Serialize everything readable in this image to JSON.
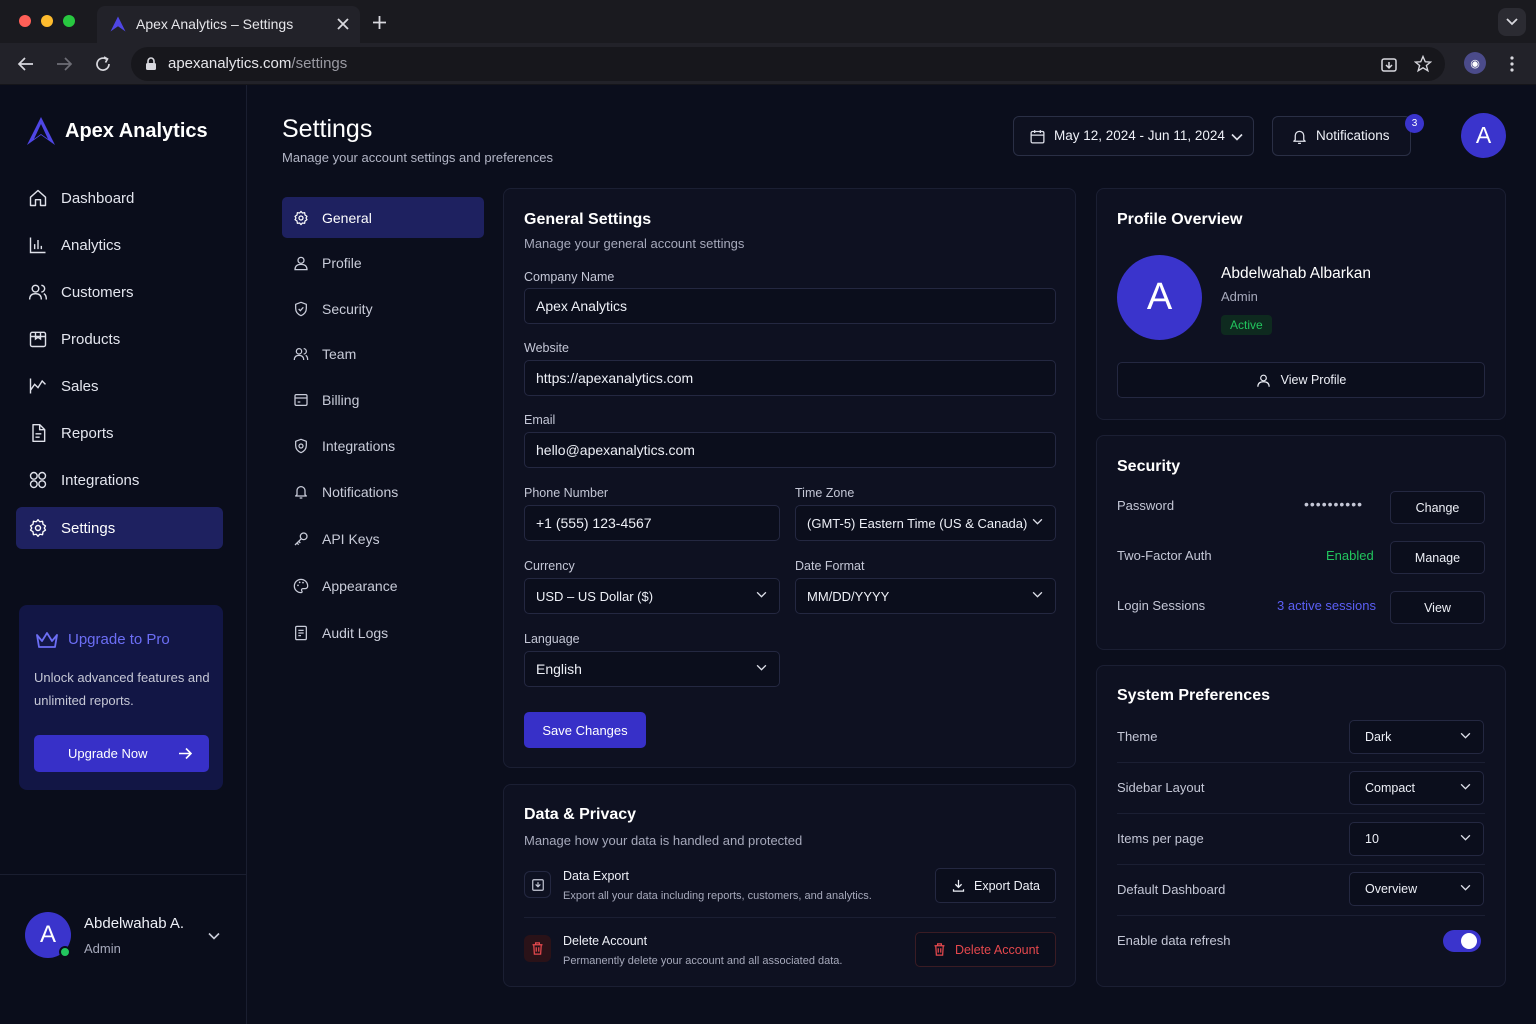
{
  "browser": {
    "tab_title": "Apex Analytics – Settings",
    "url_host": "apexanalytics.com",
    "url_path": "/settings"
  },
  "brand": {
    "name": "Apex Analytics",
    "accent": "#3a34cc"
  },
  "sidebar": {
    "items": [
      {
        "label": "Dashboard",
        "icon": "home-icon"
      },
      {
        "label": "Analytics",
        "icon": "bar-chart-icon"
      },
      {
        "label": "Customers",
        "icon": "users-icon"
      },
      {
        "label": "Products",
        "icon": "box-icon"
      },
      {
        "label": "Sales",
        "icon": "trend-icon"
      },
      {
        "label": "Reports",
        "icon": "file-icon"
      },
      {
        "label": "Integrations",
        "icon": "grid-icon"
      },
      {
        "label": "Settings",
        "icon": "gear-icon",
        "active": true
      }
    ],
    "upgrade": {
      "title": "Upgrade to Pro",
      "text": "Unlock advanced features and unlimited reports.",
      "button": "Upgrade Now"
    },
    "user": {
      "initial": "A",
      "name": "Abdelwahab A.",
      "role": "Admin"
    }
  },
  "header": {
    "title": "Settings",
    "subtitle": "Manage your account settings and preferences",
    "date_range": "May 12, 2024 - Jun 11, 2024",
    "notifications_label": "Notifications",
    "notifications_count": "3",
    "avatar_initial": "A"
  },
  "settings_nav": [
    {
      "label": "General",
      "icon": "gear-icon",
      "active": true
    },
    {
      "label": "Profile",
      "icon": "user-icon"
    },
    {
      "label": "Security",
      "icon": "shield-icon"
    },
    {
      "label": "Team",
      "icon": "users-icon"
    },
    {
      "label": "Billing",
      "icon": "credit-card-icon"
    },
    {
      "label": "Integrations",
      "icon": "plug-shield-icon"
    },
    {
      "label": "Notifications",
      "icon": "bell-icon"
    },
    {
      "label": "API Keys",
      "icon": "key-icon"
    },
    {
      "label": "Appearance",
      "icon": "palette-icon"
    },
    {
      "label": "Audit Logs",
      "icon": "document-icon"
    }
  ],
  "general": {
    "title": "General Settings",
    "subtitle": "Manage your general account settings",
    "company_label": "Company Name",
    "company_value": "Apex Analytics",
    "website_label": "Website",
    "website_value": "https://apexanalytics.com",
    "email_label": "Email",
    "email_value": "hello@apexanalytics.com",
    "phone_label": "Phone Number",
    "phone_value": "+1 (555) 123-4567",
    "timezone_label": "Time Zone",
    "timezone_value": "(GMT-5) Eastern Time (US & Canada)",
    "currency_label": "Currency",
    "currency_value": "USD – US Dollar ($)",
    "date_format_label": "Date Format",
    "date_format_value": "MM/DD/YYYY",
    "language_label": "Language",
    "language_value": "English",
    "save_button": "Save Changes"
  },
  "privacy": {
    "title": "Data & Privacy",
    "subtitle": "Manage how your data is handled and protected",
    "export_title": "Data Export",
    "export_desc": "Export all your data including reports, customers, and analytics.",
    "export_button": "Export Data",
    "delete_title": "Delete Account",
    "delete_desc": "Permanently delete your account and all associated data.",
    "delete_button": "Delete Account",
    "danger_color": "#e5484d"
  },
  "profile": {
    "title": "Profile Overview",
    "initial": "A",
    "name": "Abdelwahab Albarkan",
    "role": "Admin",
    "status": "Active",
    "view_button": "View Profile"
  },
  "security": {
    "title": "Security",
    "password_label": "Password",
    "password_value": "••••••••••",
    "password_button": "Change",
    "twofa_label": "Two-Factor Auth",
    "twofa_value": "Enabled",
    "twofa_button": "Manage",
    "sessions_label": "Login Sessions",
    "sessions_value": "3 active sessions",
    "sessions_button": "View",
    "success_color": "#22c55e",
    "link_color": "#5b5ff5"
  },
  "preferences": {
    "title": "System Preferences",
    "items": [
      {
        "label": "Theme",
        "value": "Dark"
      },
      {
        "label": "Sidebar Layout",
        "value": "Compact"
      },
      {
        "label": "Items per page",
        "value": "10"
      },
      {
        "label": "Default Dashboard",
        "value": "Overview"
      }
    ],
    "refresh_label": "Enable data refresh",
    "refresh_enabled": true
  }
}
